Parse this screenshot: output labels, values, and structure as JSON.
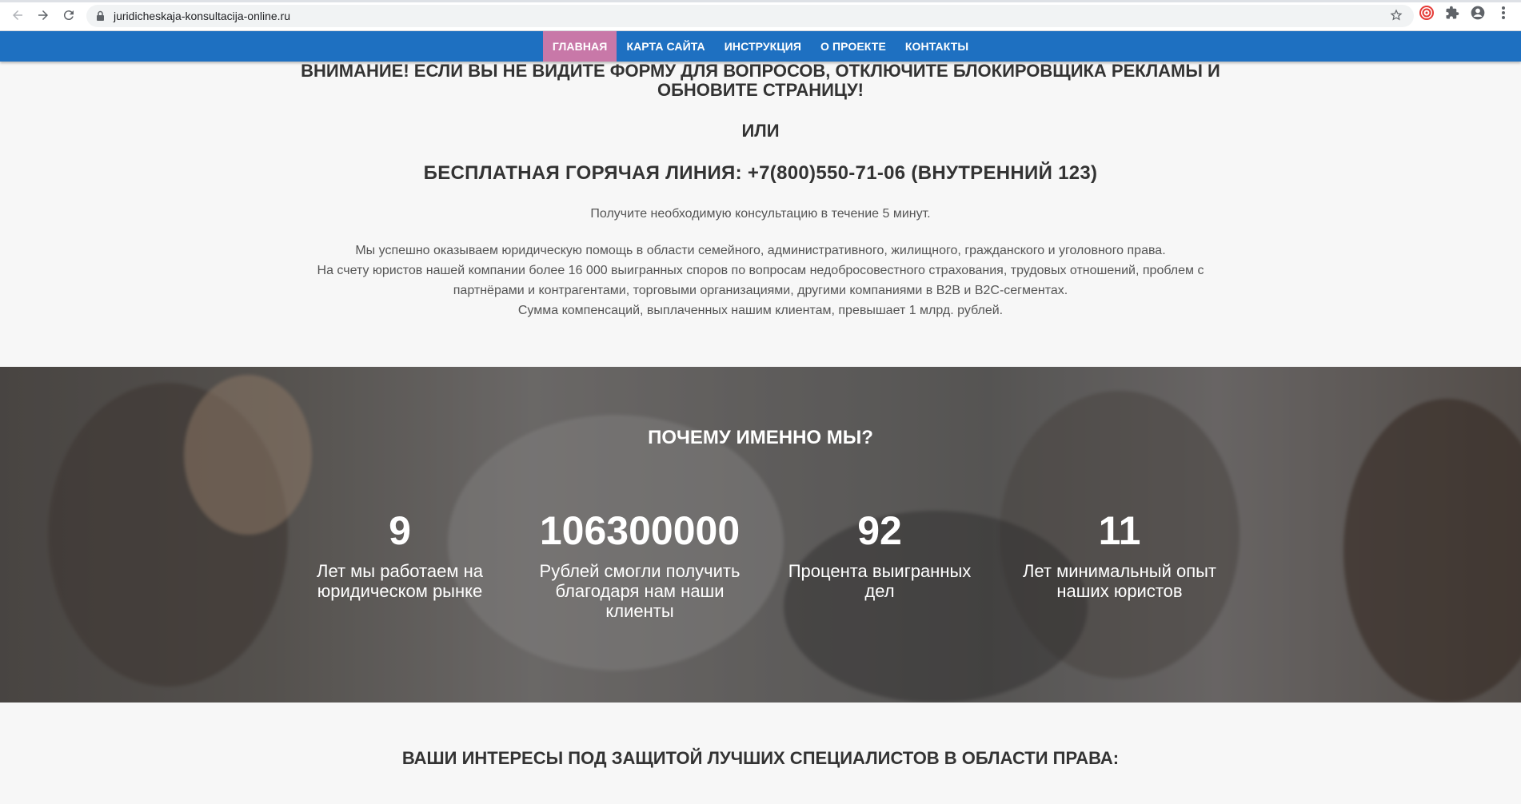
{
  "browser": {
    "url": "juridicheskaja-konsultacija-online.ru"
  },
  "nav": {
    "items": [
      {
        "label": "ГЛАВНАЯ"
      },
      {
        "label": "КАРТА САЙТА"
      },
      {
        "label": "ИНСТРУКЦИЯ"
      },
      {
        "label": "О ПРОЕКТЕ"
      },
      {
        "label": "КОНТАКТЫ"
      }
    ]
  },
  "notice": {
    "line1": "ВНИМАНИЕ! ЕСЛИ ВЫ НЕ ВИДИТЕ ФОРМУ ДЛЯ ВОПРОСОВ, ОТКЛЮЧИТЕ БЛОКИРОВЩИКА РЕКЛАМЫ И",
    "line2": "ОБНОВИТЕ СТРАНИЦУ!",
    "or": "ИЛИ",
    "hotline": "БЕСПЛАТНАЯ ГОРЯЧАЯ ЛИНИЯ: +7(800)550-71-06 (ВНУТРЕННИЙ 123)"
  },
  "intro": {
    "sub": "Получите необходимую консультацию в течение 5 минут.",
    "p1": "Мы успешно оказываем юридическую помощь в области семейного, административного, жилищного, гражданского и уголовного права.",
    "p2": "На счету юристов нашей компании более 16 000 выигранных споров по вопросам недобросовестного страхования, трудовых отношений, проблем с",
    "p3": "партнёрами и контрагентами, торговыми организациями, другими компаниями в B2B и B2C-сегментах.",
    "p4": "Сумма компенсаций, выплаченных нашим клиентам, превышает 1 млрд. рублей."
  },
  "why": {
    "title": "ПОЧЕМУ ИМЕННО МЫ?",
    "stats": [
      {
        "num": "9",
        "label1": "Лет мы работаем на",
        "label2": "юридическом рынке",
        "label3": ""
      },
      {
        "num": "106300000",
        "label1": "Рублей смогли получить",
        "label2": "благодаря нам наши",
        "label3": "клиенты"
      },
      {
        "num": "92",
        "label1": "Процента выигранных",
        "label2": "дел",
        "label3": ""
      },
      {
        "num": "11",
        "label1": "Лет минимальный опыт",
        "label2": "наших юристов",
        "label3": ""
      }
    ]
  },
  "specialists": {
    "title": "ВАШИ ИНТЕРЕСЫ ПОД ЗАЩИТОЙ ЛУЧШИХ СПЕЦИАЛИСТОВ В ОБЛАСТИ ПРАВА:"
  }
}
